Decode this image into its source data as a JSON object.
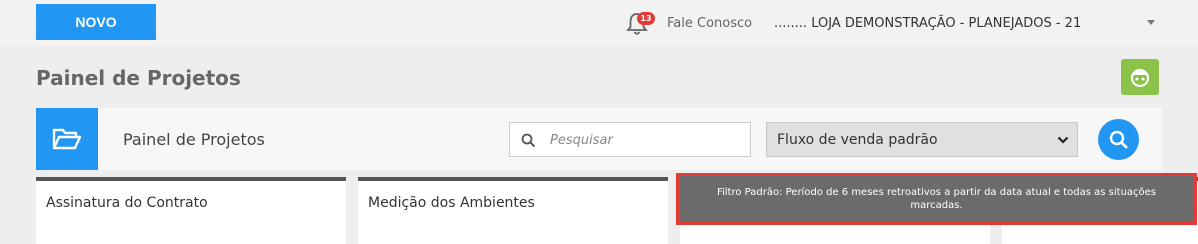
{
  "topbar": {
    "new_button": "NOVO",
    "notifications_count": "13",
    "contact_link": "Fale Conosco",
    "store_selector": "........ LOJA DEMONSTRAÇÃO - PLANEJADOS - 21"
  },
  "page": {
    "title": "Painel de Projetos"
  },
  "toolbar": {
    "title": "Painel de Projetos",
    "search_placeholder": "Pesquisar",
    "flow_select_value": "Fluxo de venda padrão"
  },
  "cards": [
    {
      "title": "Assinatura do Contrato"
    },
    {
      "title": "Medição dos Ambientes"
    },
    {
      "title": ""
    },
    {
      "title": ""
    }
  ],
  "tooltip": {
    "text": "Filtro Padrão: Período de 6 meses retroativos a partir da data atual e todas as situações marcadas."
  },
  "colors": {
    "primary": "#2196f3",
    "accent_green": "#8bc34a",
    "badge_red": "#e53935",
    "tooltip_bg": "#6b6b6b"
  }
}
